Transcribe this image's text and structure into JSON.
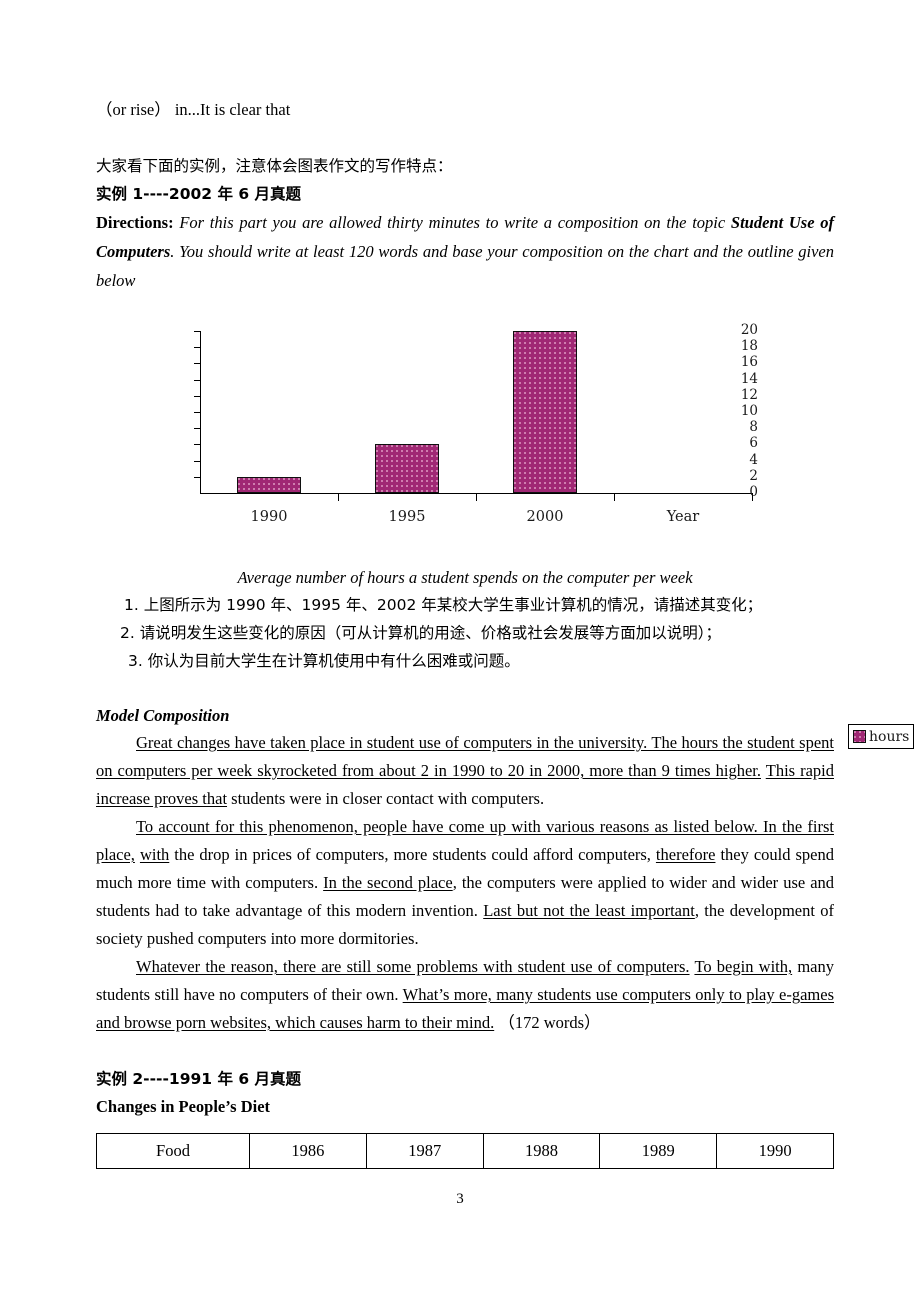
{
  "document": {
    "page_number": "3",
    "top_fragment": "（or rise）  in...It is clear that",
    "intro_cn": "大家看下面的实例，注意体会图表作文的写作特点：",
    "example1_heading": "实例 1----2002 年 6 月真题",
    "directions": {
      "label": "Directions:",
      "text_1": "For this part you are allowed thirty minutes to write a composition on the topic",
      "topic": "Student Use of Computers",
      "text_2": ". You should write at least 120 words and base your composition on the chart and the outline given below"
    },
    "chart_caption": "Average number of hours a student spends on the computer per week",
    "outline_items": [
      "1. 上图所示为 1990 年、1995 年、2002 年某校大学生事业计算机的情况，请描述其变化；",
      "2. 请说明发生这些变化的原因（可从计算机的用途、价格或社会发展等方面加以说明）；",
      "3. 你认为目前大学生在计算机使用中有什么困难或问题。"
    ],
    "model_composition": {
      "heading": "Model Composition",
      "p1": {
        "u1": "Great changes have taken place in student use of computers in the university. The hours the student spent on computers per week skyrocketed from about 2 in 1990 to 20 in 2000, more than 9 times higher.",
        "u2": "This rapid increase proves that",
        "t1": " ",
        "t2": " students were in closer contact with computers."
      },
      "p2": {
        "u1": "To account for this phenomenon, people have come up with various reasons as listed below. In the first place,",
        "u2": "with",
        "t1": " ",
        "t2": " the drop in prices of computers, more students could afford computers, ",
        "u3": "therefore",
        "t3": " they could spend much more time with computers. ",
        "u4": "In the second place",
        "t4": ", the computers were applied to wider and wider use and students had to take advantage of this modern invention. ",
        "u5": "Last but not the least important",
        "t5": ", the development of society pushed computers into more dormitories."
      },
      "p3": {
        "u1": "Whatever the reason, there are still some problems with student use of computers.",
        "u2": "To begin with,",
        "t1": " ",
        "t2": " many students still have no computers of their own. ",
        "u3": "What’s more, many students use computers only to play e-games and browse porn websites, which causes harm to their mind.",
        "t3": "  （172 words）"
      }
    },
    "example2_heading": "实例 2----1991 年 6 月真题",
    "example2_title": "Changes in People’s Diet",
    "diet_table": {
      "headers": [
        "Food",
        "1986",
        "1987",
        "1988",
        "1989",
        "1990"
      ]
    }
  },
  "chart_data": {
    "type": "bar",
    "title": "",
    "caption": "Average number of hours a student spends on the computer per week",
    "categories": [
      "1990",
      "1995",
      "2000",
      "Year"
    ],
    "values": [
      2,
      6,
      20,
      0
    ],
    "series": [
      {
        "name": "hours",
        "values": [
          2,
          6,
          20,
          0
        ]
      }
    ],
    "legend": {
      "entries": [
        "hours"
      ],
      "position": "right"
    },
    "xlabel": "",
    "ylabel": "",
    "ylim": [
      0,
      20
    ],
    "ytick_step": 2,
    "yticks": [
      0,
      2,
      4,
      6,
      8,
      10,
      12,
      14,
      16,
      18,
      20
    ],
    "grid": false,
    "bar_color": "#a02874",
    "bar_border_color": "#101010",
    "axis_color": "#000000"
  }
}
